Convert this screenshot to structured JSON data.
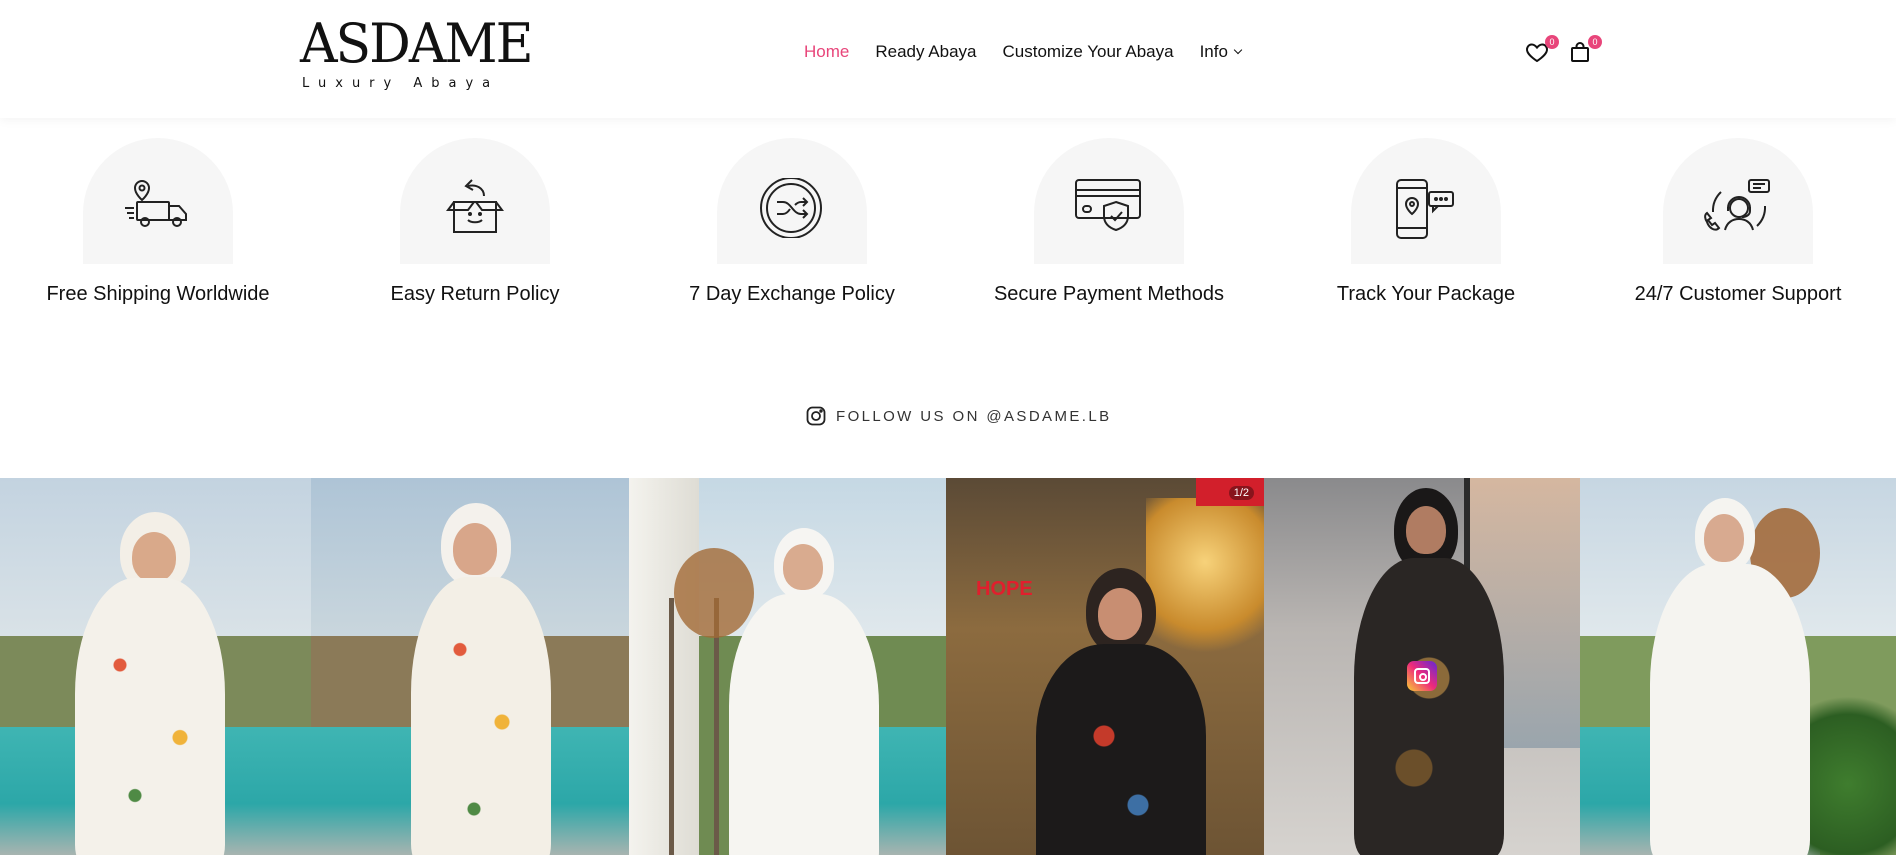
{
  "header": {
    "logo": {
      "main": "ASDAME",
      "sub": "Luxury Abaya"
    },
    "nav": [
      {
        "label": "Home",
        "active": true
      },
      {
        "label": "Ready Abaya",
        "active": false
      },
      {
        "label": "Customize Your Abaya",
        "active": false
      },
      {
        "label": "Info",
        "active": false
      }
    ],
    "wishlist": {
      "icon": "heart-icon",
      "count": "0"
    },
    "cart": {
      "icon": "shopping-bag-icon",
      "count": "0"
    }
  },
  "features": [
    {
      "icon": "delivery-truck-icon",
      "label": "Free Shipping Worldwide"
    },
    {
      "icon": "return-box-icon",
      "label": "Easy Return Policy"
    },
    {
      "icon": "shuffle-exchange-icon",
      "label": "7 Day Exchange Policy"
    },
    {
      "icon": "secure-card-icon",
      "label": "Secure Payment Methods"
    },
    {
      "icon": "phone-location-icon",
      "label": "Track Your Package"
    },
    {
      "icon": "customer-support-icon",
      "label": "24/7 Customer Support"
    }
  ],
  "follow": {
    "icon": "instagram-icon",
    "text": "FOLLOW US ON @ASDAME.LB"
  },
  "gallery": {
    "counter": "1/2"
  },
  "colors": {
    "accent": "#e8457a",
    "feature_bg": "#f6f6f6",
    "text": "#111111"
  }
}
